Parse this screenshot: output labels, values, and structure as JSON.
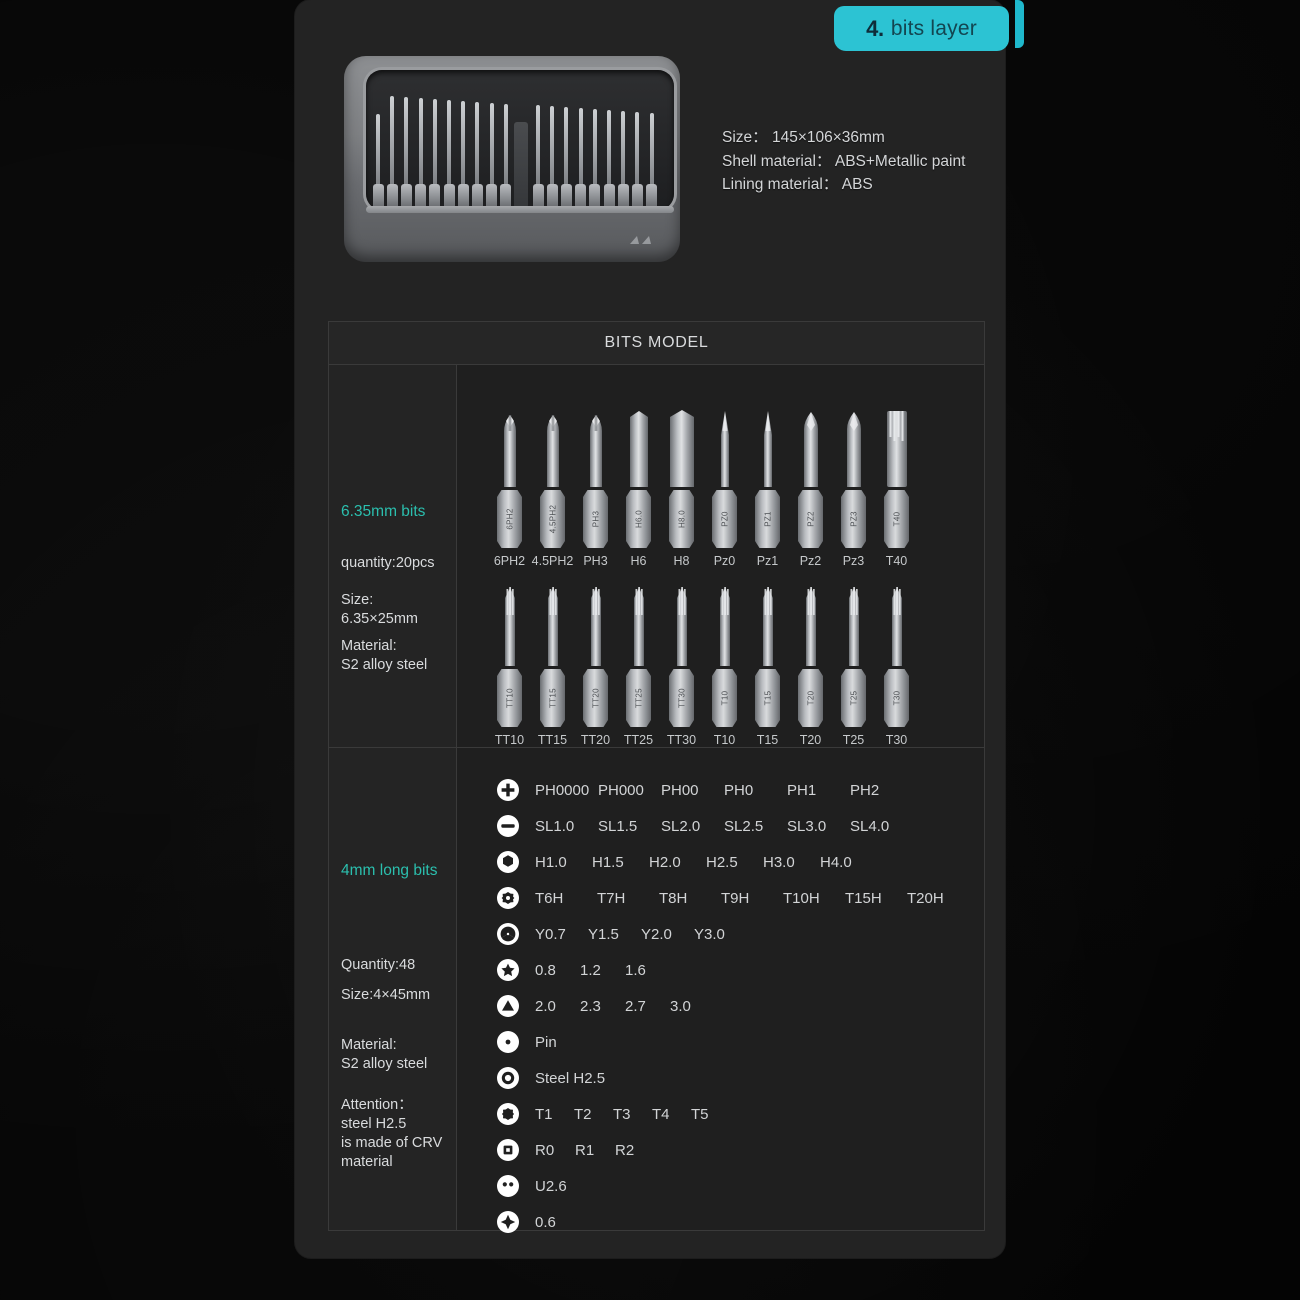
{
  "tab": {
    "number": "4.",
    "label": "bits layer"
  },
  "specs": [
    "Size： 145×106×36mm",
    "Shell material： ABS+Metallic paint",
    "Lining material： ABS"
  ],
  "table": {
    "header": "BITS MODEL",
    "section_635": {
      "title": "6.35mm bits",
      "quantity": "quantity:20pcs",
      "size_label": "Size:",
      "size_value": "6.35×25mm",
      "material_label": "Material:",
      "material_value": "S2 alloy steel",
      "row1": [
        {
          "label": "6PH2",
          "engrave": "6PH2",
          "tip": "phillips"
        },
        {
          "label": "4.5PH2",
          "engrave": "4.5PH2",
          "tip": "phillips"
        },
        {
          "label": "PH3",
          "engrave": "PH3",
          "tip": "phillips"
        },
        {
          "label": "H6",
          "engrave": "H6.0",
          "tip": "hex6"
        },
        {
          "label": "H8",
          "engrave": "H8.0",
          "tip": "hex8"
        },
        {
          "label": "Pz0",
          "engrave": "PZ0",
          "tip": "pozi-thin"
        },
        {
          "label": "Pz1",
          "engrave": "PZ1",
          "tip": "pozi-thin"
        },
        {
          "label": "Pz2",
          "engrave": "PZ2",
          "tip": "pozi"
        },
        {
          "label": "Pz3",
          "engrave": "PZ3",
          "tip": "pozi"
        },
        {
          "label": "T40",
          "engrave": "T40",
          "tip": "torx-wide"
        }
      ],
      "row2": [
        {
          "label": "TT10",
          "engrave": "TT10",
          "tip": "torx"
        },
        {
          "label": "TT15",
          "engrave": "TT15",
          "tip": "torx"
        },
        {
          "label": "TT20",
          "engrave": "TT20",
          "tip": "torx"
        },
        {
          "label": "TT25",
          "engrave": "TT25",
          "tip": "torx"
        },
        {
          "label": "TT30",
          "engrave": "TT30",
          "tip": "torx"
        },
        {
          "label": "T10",
          "engrave": "T10",
          "tip": "torx"
        },
        {
          "label": "T15",
          "engrave": "T15",
          "tip": "torx"
        },
        {
          "label": "T20",
          "engrave": "T20",
          "tip": "torx"
        },
        {
          "label": "T25",
          "engrave": "T25",
          "tip": "torx"
        },
        {
          "label": "T30",
          "engrave": "T30",
          "tip": "torx"
        }
      ]
    },
    "section_4mm": {
      "title": "4mm long bits",
      "quantity": "Quantity:48",
      "size": "Size:4×45mm",
      "material_label": "Material:",
      "material_value": "S2 alloy steel",
      "attention_label": "Attention：",
      "attention_l1": "steel H2.5",
      "attention_l2": "is made of CRV",
      "attention_l3": "material",
      "rows": [
        {
          "icon": "phillips-icon",
          "values": [
            "PH0000",
            "PH000",
            "PH00",
            "PH0",
            "PH1",
            "PH2"
          ]
        },
        {
          "icon": "slotted-icon",
          "values": [
            "SL1.0",
            "SL1.5",
            "SL2.0",
            "SL2.5",
            "SL3.0",
            "SL4.0"
          ]
        },
        {
          "icon": "hex-icon",
          "values": [
            "H1.0",
            "H1.5",
            "H2.0",
            "H2.5",
            "H3.0",
            "H4.0"
          ]
        },
        {
          "icon": "torx-hole-icon",
          "values": [
            "T6H",
            "T7H",
            "T8H",
            "T9H",
            "T10H",
            "T15H",
            "T20H"
          ]
        },
        {
          "icon": "tri-wing-icon",
          "values": [
            "Y0.7",
            "Y1.5",
            "Y2.0",
            "Y3.0"
          ]
        },
        {
          "icon": "pentalobe-icon",
          "values": [
            "0.8",
            "1.2",
            "1.6"
          ]
        },
        {
          "icon": "triangle-icon",
          "values": [
            "2.0",
            "2.3",
            "2.7",
            "3.0"
          ]
        },
        {
          "icon": "pin-icon",
          "values": [
            "Pin"
          ]
        },
        {
          "icon": "socket-icon",
          "values": [
            "Steel H2.5"
          ]
        },
        {
          "icon": "torx-icon",
          "values": [
            "T1",
            "T2",
            "T3",
            "T4",
            "T5"
          ]
        },
        {
          "icon": "square-icon",
          "values": [
            "R0",
            "R1",
            "R2"
          ]
        },
        {
          "icon": "spanner-icon",
          "values": [
            "U2.6"
          ]
        },
        {
          "icon": "cross-icon",
          "values": [
            "0.6"
          ]
        }
      ]
    }
  },
  "colors": {
    "accent_teal": "#2cc3d3",
    "category_teal": "#2bbfae",
    "panel_bg": "#232323",
    "page_bg": "#040404",
    "text": "#d4d6d8"
  }
}
